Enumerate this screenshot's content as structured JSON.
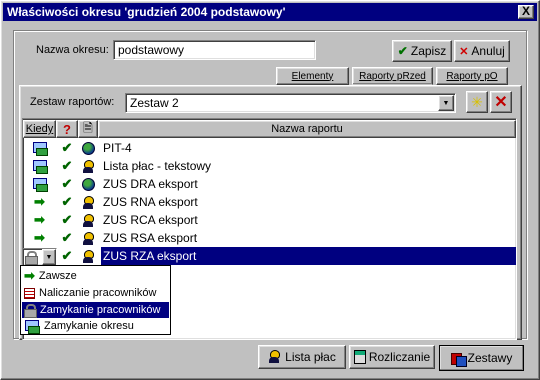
{
  "window": {
    "title": "Właściwości okresu 'grudzień 2004 podstawowy'",
    "close_glyph": "X"
  },
  "period": {
    "name_label": "Nazwa okresu:",
    "name_value": "podstawowy",
    "save_label": "Zapisz",
    "cancel_label": "Anuluj"
  },
  "tabs": [
    {
      "label": "Elementy",
      "active": false
    },
    {
      "label": "Raporty pRzed",
      "active": true
    },
    {
      "label": "Raporty pO",
      "active": false
    }
  ],
  "report_set": {
    "label": "Zestaw raportów:",
    "selected": "Zestaw 2"
  },
  "grid": {
    "columns": {
      "when": "Kiedy",
      "include": "?",
      "type": "",
      "name": "Nazwa raportu"
    },
    "rows": [
      {
        "when_icon": "period-close-icon",
        "checked": true,
        "type_icon": "globe-icon",
        "name": "PIT-4",
        "selected": false
      },
      {
        "when_icon": "period-close-icon",
        "checked": true,
        "type_icon": "person-icon",
        "name": "Lista płac - tekstowy",
        "selected": false
      },
      {
        "when_icon": "period-close-icon",
        "checked": true,
        "type_icon": "globe-icon",
        "name": "ZUS DRA eksport",
        "selected": false
      },
      {
        "when_icon": "always-arrow-icon",
        "checked": true,
        "type_icon": "person-icon",
        "name": "ZUS RNA eksport",
        "selected": false
      },
      {
        "when_icon": "always-arrow-icon",
        "checked": true,
        "type_icon": "person-icon",
        "name": "ZUS RCA eksport",
        "selected": false
      },
      {
        "when_icon": "always-arrow-icon",
        "checked": true,
        "type_icon": "person-icon",
        "name": "ZUS RSA eksport",
        "selected": false
      },
      {
        "when_icon": "lock-icon",
        "checked": true,
        "type_icon": "person-icon",
        "name": "ZUS RZA eksport",
        "selected": true
      }
    ]
  },
  "when_dropdown": {
    "options": [
      {
        "label": "Zawsze",
        "icon": "always-arrow-icon",
        "selected": false
      },
      {
        "label": "Naliczanie pracowników",
        "icon": "calculation-icon",
        "selected": false
      },
      {
        "label": "Zamykanie pracowników",
        "icon": "lock-icon",
        "selected": true
      },
      {
        "label": "Zamykanie okresu",
        "icon": "period-close-icon",
        "selected": false
      }
    ]
  },
  "bottom_buttons": [
    {
      "label": "Lista płac"
    },
    {
      "label": "Rozliczanie"
    },
    {
      "label": "Zestawy"
    }
  ],
  "colors": {
    "title_bar": "#000080",
    "selection": "#000080",
    "face": "#c0c0c0"
  }
}
